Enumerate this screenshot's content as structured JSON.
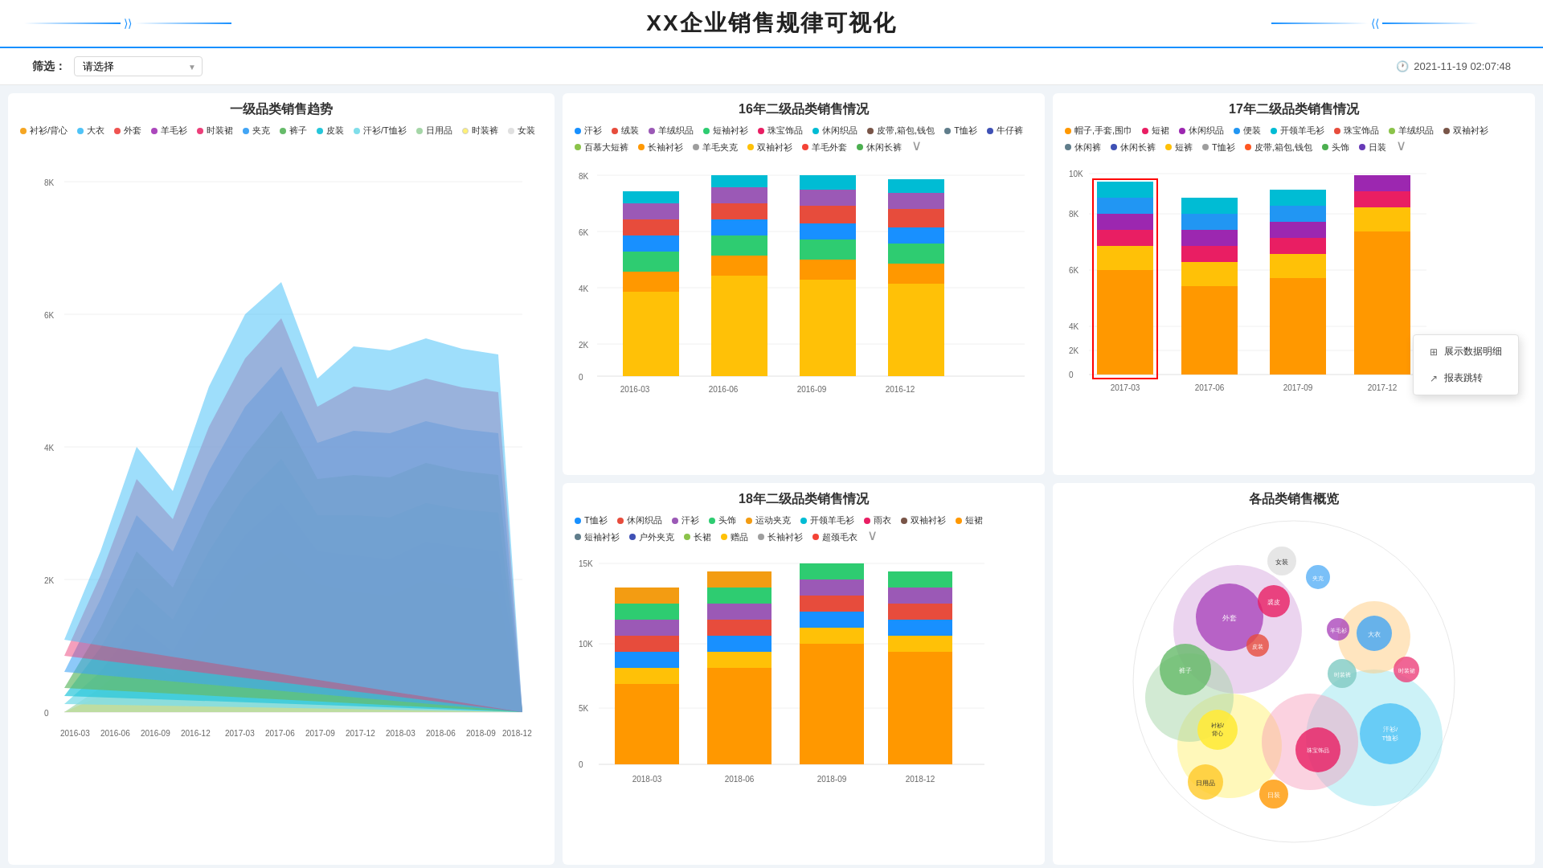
{
  "header": {
    "title": "XX企业销售规律可视化",
    "datetime": "2021-11-19 02:07:48"
  },
  "toolbar": {
    "filter_label": "筛选：",
    "filter_placeholder": "请选择",
    "filter_arrow": "▼"
  },
  "charts": {
    "area_chart": {
      "title": "一级品类销售趋势",
      "y_labels": [
        "8K",
        "6K",
        "4K",
        "2K",
        "0"
      ],
      "x_labels": [
        "2016-03",
        "2016-06",
        "2016-09",
        "2016-12",
        "2017-03",
        "2017-06",
        "2017-09",
        "2017-12",
        "2018-03",
        "2018-06",
        "2018-09",
        "2018-12"
      ],
      "legend": [
        {
          "label": "衬衫/背心",
          "color": "#f5a623"
        },
        {
          "label": "大衣",
          "color": "#4fc3f7"
        },
        {
          "label": "外套",
          "color": "#ef5350"
        },
        {
          "label": "羊毛衫",
          "color": "#ab47bc"
        },
        {
          "label": "时装裙",
          "color": "#ec407a"
        },
        {
          "label": "夹克",
          "color": "#42a5f5"
        },
        {
          "label": "裤子",
          "color": "#66bb6a"
        },
        {
          "label": "皮装",
          "color": "#26c6da"
        },
        {
          "label": "汗衫/T恤衫",
          "color": "#80deea"
        },
        {
          "label": "日用品",
          "color": "#a5d6a7"
        },
        {
          "label": "时装裤",
          "color": "#fff176"
        },
        {
          "label": "女装",
          "color": "#e0e0e0"
        }
      ]
    },
    "bar_chart_16": {
      "title": "16年二级品类销售情况",
      "y_labels": [
        "8K",
        "6K",
        "4K",
        "2K",
        "0"
      ],
      "x_labels": [
        "2016-03",
        "2016-06",
        "2016-09",
        "2016-12"
      ],
      "legend": [
        {
          "label": "汗衫",
          "color": "#1890ff"
        },
        {
          "label": "绒装",
          "color": "#e74c3c"
        },
        {
          "label": "羊绒织品",
          "color": "#9b59b6"
        },
        {
          "label": "短袖衬衫",
          "color": "#2ecc71"
        },
        {
          "label": "珠宝饰品",
          "color": "#e91e63"
        },
        {
          "label": "休闲织品",
          "color": "#00bcd4"
        },
        {
          "label": "皮带,箱包,钱包",
          "color": "#795548"
        },
        {
          "label": "T恤衫",
          "color": "#607d8b"
        },
        {
          "label": "牛仔裤",
          "color": "#3f51b5"
        },
        {
          "label": "百慕大短裤",
          "color": "#8bc34a"
        },
        {
          "label": "长袖衬衫",
          "color": "#ff9800"
        },
        {
          "label": "羊毛夹克",
          "color": "#9e9e9e"
        },
        {
          "label": "双袖衬衫",
          "color": "#ffc107"
        },
        {
          "label": "羊毛外套",
          "color": "#f44336"
        },
        {
          "label": "休闲长裤",
          "color": "#4caf50"
        }
      ]
    },
    "bar_chart_17": {
      "title": "17年二级品类销售情况",
      "y_labels": [
        "10K",
        "8K",
        "6K",
        "4K",
        "2K",
        "0"
      ],
      "x_labels": [
        "2017-03",
        "2017-06",
        "2017-09",
        "2017-12"
      ],
      "legend": [
        {
          "label": "帽子,手套,围巾",
          "color": "#ff9800"
        },
        {
          "label": "短裙",
          "color": "#e91e63"
        },
        {
          "label": "休闲织品",
          "color": "#9c27b0"
        },
        {
          "label": "便装",
          "color": "#2196f3"
        },
        {
          "label": "开领羊毛衫",
          "color": "#00bcd4"
        },
        {
          "label": "珠宝饰品",
          "color": "#e74c3c"
        },
        {
          "label": "羊绒织品",
          "color": "#8bc34a"
        },
        {
          "label": "双袖衬衫",
          "color": "#795548"
        },
        {
          "label": "休闲裤",
          "color": "#607d8b"
        },
        {
          "label": "休闲长裤",
          "color": "#3f51b5"
        },
        {
          "label": "短裤",
          "color": "#ffc107"
        },
        {
          "label": "T恤衫",
          "color": "#9e9e9e"
        },
        {
          "label": "皮带,箱包,钱包",
          "color": "#ff5722"
        },
        {
          "label": "头饰",
          "color": "#4caf50"
        },
        {
          "label": "日装",
          "color": "#673ab7"
        }
      ],
      "context_menu": {
        "items": [
          {
            "icon": "⊞",
            "label": "展示数据明细",
            "active": false
          },
          {
            "icon": "↗",
            "label": "报表跳转",
            "active": false
          }
        ]
      }
    },
    "bar_chart_18": {
      "title": "18年二级品类销售情况",
      "y_labels": [
        "15K",
        "10K",
        "5K",
        "0"
      ],
      "x_labels": [
        "2018-03",
        "2018-06",
        "2018-09",
        "2018-12"
      ],
      "legend": [
        {
          "label": "T恤衫",
          "color": "#1890ff"
        },
        {
          "label": "休闲织品",
          "color": "#e74c3c"
        },
        {
          "label": "汗衫",
          "color": "#9b59b6"
        },
        {
          "label": "头饰",
          "color": "#2ecc71"
        },
        {
          "label": "运动夹克",
          "color": "#f39c12"
        },
        {
          "label": "开领羊毛衫",
          "color": "#00bcd4"
        },
        {
          "label": "雨衣",
          "color": "#e91e63"
        },
        {
          "label": "双袖衬衫",
          "color": "#795548"
        },
        {
          "label": "短裙",
          "color": "#ff9800"
        },
        {
          "label": "短袖衬衫",
          "color": "#607d8b"
        },
        {
          "label": "户外夹克",
          "color": "#3f51b5"
        },
        {
          "label": "长裙",
          "color": "#8bc34a"
        },
        {
          "label": "赠品",
          "color": "#ffc107"
        },
        {
          "label": "长袖衬衫",
          "color": "#9e9e9e"
        },
        {
          "label": "超颈毛衣",
          "color": "#f44336"
        }
      ]
    },
    "bubble_chart": {
      "title": "各品类销售概览",
      "bubbles": [
        {
          "label": "外套",
          "color": "#ab47bc",
          "x": 55,
          "y": 35,
          "r": 45
        },
        {
          "label": "裘皮",
          "color": "#e91e63",
          "x": 85,
          "y": 40,
          "r": 18
        },
        {
          "label": "皮装",
          "color": "#e91e63",
          "x": 70,
          "y": 25,
          "r": 12
        },
        {
          "label": "汗衫/T恤衫",
          "color": "#4fc3f7",
          "x": 88,
          "y": 70,
          "r": 40
        },
        {
          "label": "珠宝饰品",
          "color": "#e91e63",
          "x": 63,
          "y": 75,
          "r": 30
        },
        {
          "label": "衬衫/背心",
          "color": "#ffeb3b",
          "x": 43,
          "y": 65,
          "r": 28
        },
        {
          "label": "日用品",
          "color": "#ffeb3b",
          "x": 30,
          "y": 80,
          "r": 22
        },
        {
          "label": "日装",
          "color": "#ff9800",
          "x": 68,
          "y": 58,
          "r": 18
        },
        {
          "label": "裤子",
          "color": "#66bb6a",
          "x": 18,
          "y": 60,
          "r": 35
        },
        {
          "label": "时装裤",
          "color": "#80cbc4",
          "x": 28,
          "y": 45,
          "r": 20
        }
      ]
    }
  }
}
